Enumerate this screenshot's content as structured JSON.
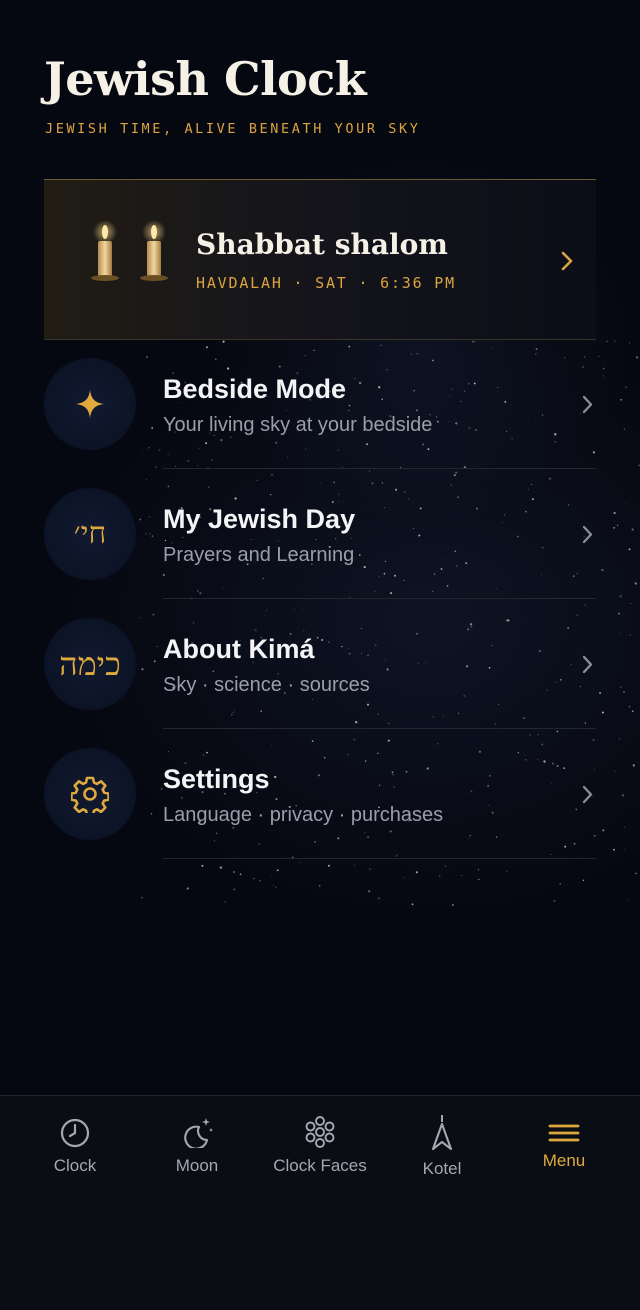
{
  "app": {
    "title": "Jewish Clock",
    "tagline": "JEWISH TIME, ALIVE BENEATH YOUR SKY"
  },
  "shabbat_card": {
    "title": "Shabbat shalom",
    "subtitle": "HAVDALAH · SAT · 6:36 PM",
    "icon": "candles-icon"
  },
  "menu": {
    "items": [
      {
        "title": "Bedside Mode",
        "subtitle": "Your living sky at your bedside",
        "icon": "sparkle-icon"
      },
      {
        "title": "My Jewish Day",
        "subtitle": "Prayers and Learning",
        "icon_text": "חי׳"
      },
      {
        "title": "About Kimá",
        "subtitle": "Sky · science · sources",
        "icon_text": "כימה"
      },
      {
        "title": "Settings",
        "subtitle": "Language · privacy · purchases",
        "icon": "gear-icon"
      }
    ]
  },
  "tabs": [
    {
      "label": "Clock",
      "icon": "clock-icon"
    },
    {
      "label": "Moon",
      "icon": "moon-icon"
    },
    {
      "label": "Clock Faces",
      "icon": "flower-icon"
    },
    {
      "label": "Kotel",
      "icon": "kotel-arrow-icon"
    },
    {
      "label": "Menu",
      "icon": "hamburger-icon",
      "active": true
    }
  ],
  "colors": {
    "background": "#060811",
    "accent_gold": "#d9a441",
    "tab_inactive": "#a3a7b0"
  }
}
